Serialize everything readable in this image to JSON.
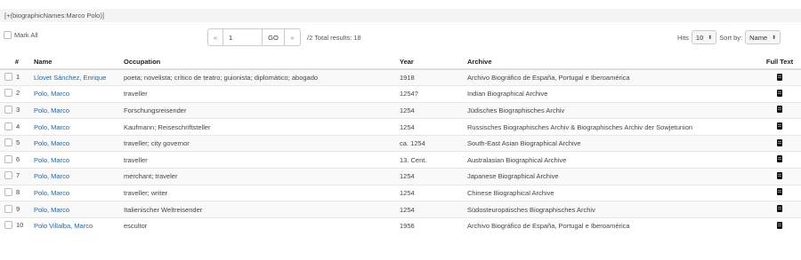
{
  "query": {
    "text": "[+(biographicNames:Marco Polo)]"
  },
  "controls": {
    "mark_all_label": "Mark All",
    "prev_symbol": "«",
    "page_value": "1",
    "go_label": "GO",
    "next_symbol": "»",
    "total_text": "/2 Total results: 18",
    "hits_label": "Hits",
    "hits_value": "10",
    "sort_label": "Sort by:",
    "sort_value": "Name"
  },
  "table": {
    "headers": {
      "num": "#",
      "name": "Name",
      "occupation": "Occupation",
      "year": "Year",
      "archive": "Archive",
      "fulltext": "Full Text"
    },
    "rows": [
      {
        "num": "1",
        "name": "Llovet Sánchez, Enrique",
        "occupation": "poeta; novelista; crítico de teatro; guionista; diplomático; abogado",
        "year": "1918",
        "archive": "Archivo Biográfico de España, Portugal e Iberoamérica"
      },
      {
        "num": "2",
        "name": "Polo, Marco",
        "occupation": "traveller",
        "year": "1254?",
        "archive": "Indian Biographical Archive"
      },
      {
        "num": "3",
        "name": "Polo, Marco",
        "occupation": "Forschungsreisender",
        "year": "1254",
        "archive": "Jüdisches Biographisches Archiv"
      },
      {
        "num": "4",
        "name": "Polo, Marco",
        "occupation": "Kaufmann; Reiseschriftsteller",
        "year": "1254",
        "archive": "Russisches Biographisches Archiv & Biographisches Archiv der Sowjetunion"
      },
      {
        "num": "5",
        "name": "Polo, Marco",
        "occupation": "traveller; city governor",
        "year": "ca. 1254",
        "archive": "South-East Asian Biographical Archive"
      },
      {
        "num": "6",
        "name": "Polo, Marco",
        "occupation": "traveller",
        "year": "13. Cent.",
        "archive": "Australasian Biographical Archive"
      },
      {
        "num": "7",
        "name": "Polo, Marco",
        "occupation": "merchant; traveler",
        "year": "1254",
        "archive": "Japanese Biographical Archive"
      },
      {
        "num": "8",
        "name": "Polo, Marco",
        "occupation": "traveller; writer",
        "year": "1254",
        "archive": "Chinese Biographical Archive"
      },
      {
        "num": "9",
        "name": "Polo, Marco",
        "occupation": "Italienischer Weltreisender",
        "year": "1254",
        "archive": "Südosteuropäisches Biographisches Archiv"
      },
      {
        "num": "10",
        "name": "Polo Villalba, Marco",
        "occupation": "escultor",
        "year": "1956",
        "archive": "Archivo Biográfico de España, Portugal e Iberoamérica"
      }
    ]
  },
  "icons": {
    "fulltext": "document-icon",
    "checkbox": "checkbox-icon"
  },
  "colors": {
    "link": "#2a6496",
    "stripe": "#f9f9f9",
    "query_bar": "#f4f4f4"
  }
}
